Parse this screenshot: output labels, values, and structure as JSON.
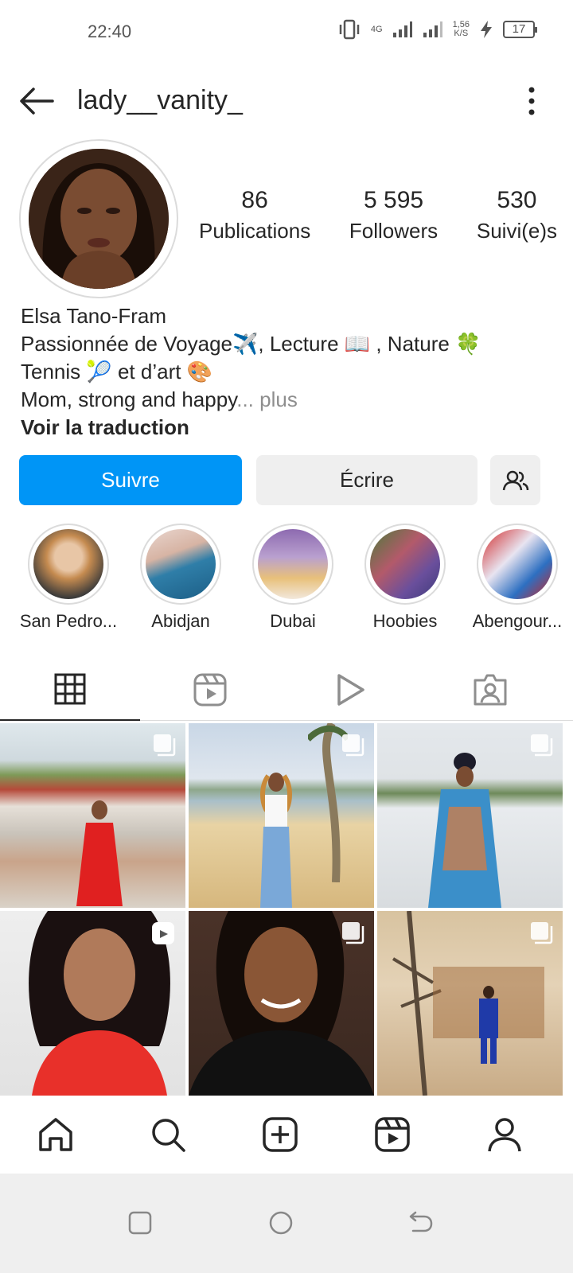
{
  "status_bar": {
    "time": "22:40",
    "network": "4G",
    "speed_value": "1,56",
    "speed_unit": "K/S",
    "battery": "17"
  },
  "header": {
    "username": "lady__vanity_"
  },
  "stats": [
    {
      "value": "86",
      "label": "Publications"
    },
    {
      "value": "5 595",
      "label": "Followers"
    },
    {
      "value": "530",
      "label": "Suivi(e)s"
    }
  ],
  "bio": {
    "name": "Elsa Tano-Fram",
    "line1": "Passionnée de Voyage✈️, Lecture 📖 , Nature 🍀",
    "line2": "Tennis 🎾 et d’art 🎨",
    "line3": "Mom, strong and happy",
    "more": "... plus",
    "translate": "Voir la traduction"
  },
  "actions": {
    "follow": "Suivre",
    "message": "Écrire"
  },
  "highlights": [
    {
      "label": "San Pedro..."
    },
    {
      "label": "Abidjan"
    },
    {
      "label": "Dubai"
    },
    {
      "label": "Hoobies"
    },
    {
      "label": "Abengour..."
    }
  ],
  "colors": {
    "accent": "#0095f6",
    "text": "#262626",
    "muted": "#8e8e8e",
    "button_bg": "#efefef"
  },
  "tabs": [
    {
      "icon": "grid-icon"
    },
    {
      "icon": "reels-icon"
    },
    {
      "icon": "video-icon"
    },
    {
      "icon": "tagged-icon"
    }
  ],
  "bottom_nav": [
    {
      "icon": "home-icon"
    },
    {
      "icon": "search-icon"
    },
    {
      "icon": "new-post-icon"
    },
    {
      "icon": "reels-icon"
    },
    {
      "icon": "profile-icon"
    }
  ]
}
